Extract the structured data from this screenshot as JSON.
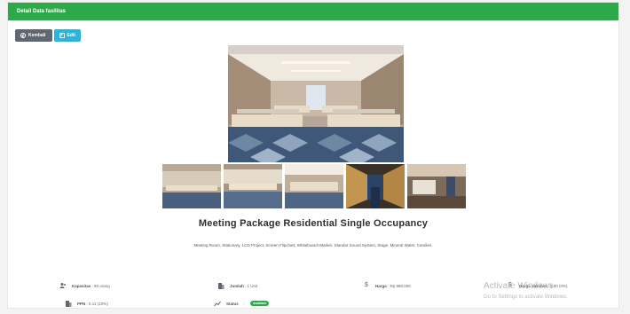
{
  "header": {
    "title": "Detail Data fasilitas"
  },
  "toolbar": {
    "back_label": "Kembali",
    "edit_label": "Edit"
  },
  "facility": {
    "title": "Meeting Package Residential Single Occupancy",
    "description": "Meeting Room, Stationary, LCD Project, Screen Flipchart, Whiteboard+Marker, Standar Sound System, Stage, Mineral Water, Candies."
  },
  "info": {
    "capacity": {
      "label": "Kapasitas",
      "value": ": 50 orang"
    },
    "quantity": {
      "label": "Jumlah",
      "value": ": 1 Unit"
    },
    "price": {
      "label": "Harga",
      "value": ": Rp 980,000"
    },
    "member_price": {
      "label": "Harga Member",
      "value": ": 0.00 (0%)"
    },
    "tax": {
      "label": "PPN",
      "value": ": 0.11 (10%)"
    },
    "status": {
      "label": "Status",
      "value": ":",
      "badge": "Available"
    }
  },
  "watermark": {
    "line1": "Activate Windows",
    "line2": "Go to Settings to activate Windows."
  },
  "colors": {
    "header": "#2ea94a",
    "back_button": "#5f6770",
    "edit_button": "#28b6df"
  }
}
